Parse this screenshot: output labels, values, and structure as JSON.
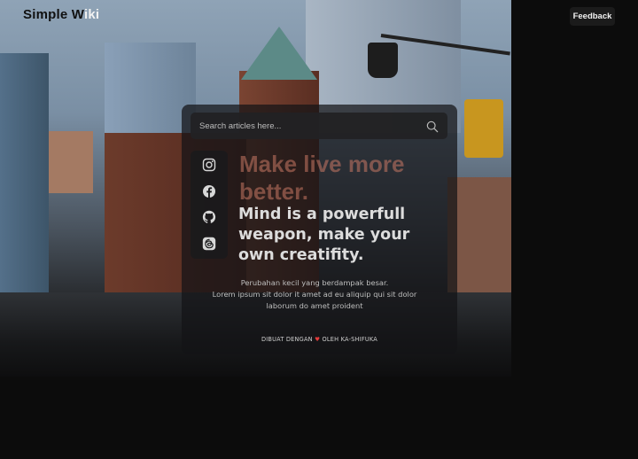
{
  "header": {
    "site_title_part1": "Simple W",
    "site_title_part2": "iki",
    "feedback_label": "Feedback"
  },
  "search": {
    "placeholder": "Search articles here...",
    "icon": "search-icon"
  },
  "socials": [
    {
      "icon": "instagram-icon"
    },
    {
      "icon": "facebook-icon"
    },
    {
      "icon": "github-icon"
    },
    {
      "icon": "threads-icon"
    }
  ],
  "hero": {
    "ghost_line1": "Make live more",
    "ghost_line2": "better.",
    "headline": "Mind is a powerfull weapon, make your own creatifity.",
    "desc_line1": "Perubahan kecil yang berdampak besar.",
    "desc_line2": "Lorem ipsum sit dolor it amet ad eu aliquip qui sit dolor laborum do amet proident"
  },
  "footer": {
    "credit_before": "DIBUAT DENGAN",
    "heart": "♥",
    "credit_after": "OLEH KA-SHIFUKA"
  },
  "colors": {
    "accent_heart": "#e33b3b",
    "card_bg": "#141416",
    "page_bg": "#0a0a0a"
  }
}
